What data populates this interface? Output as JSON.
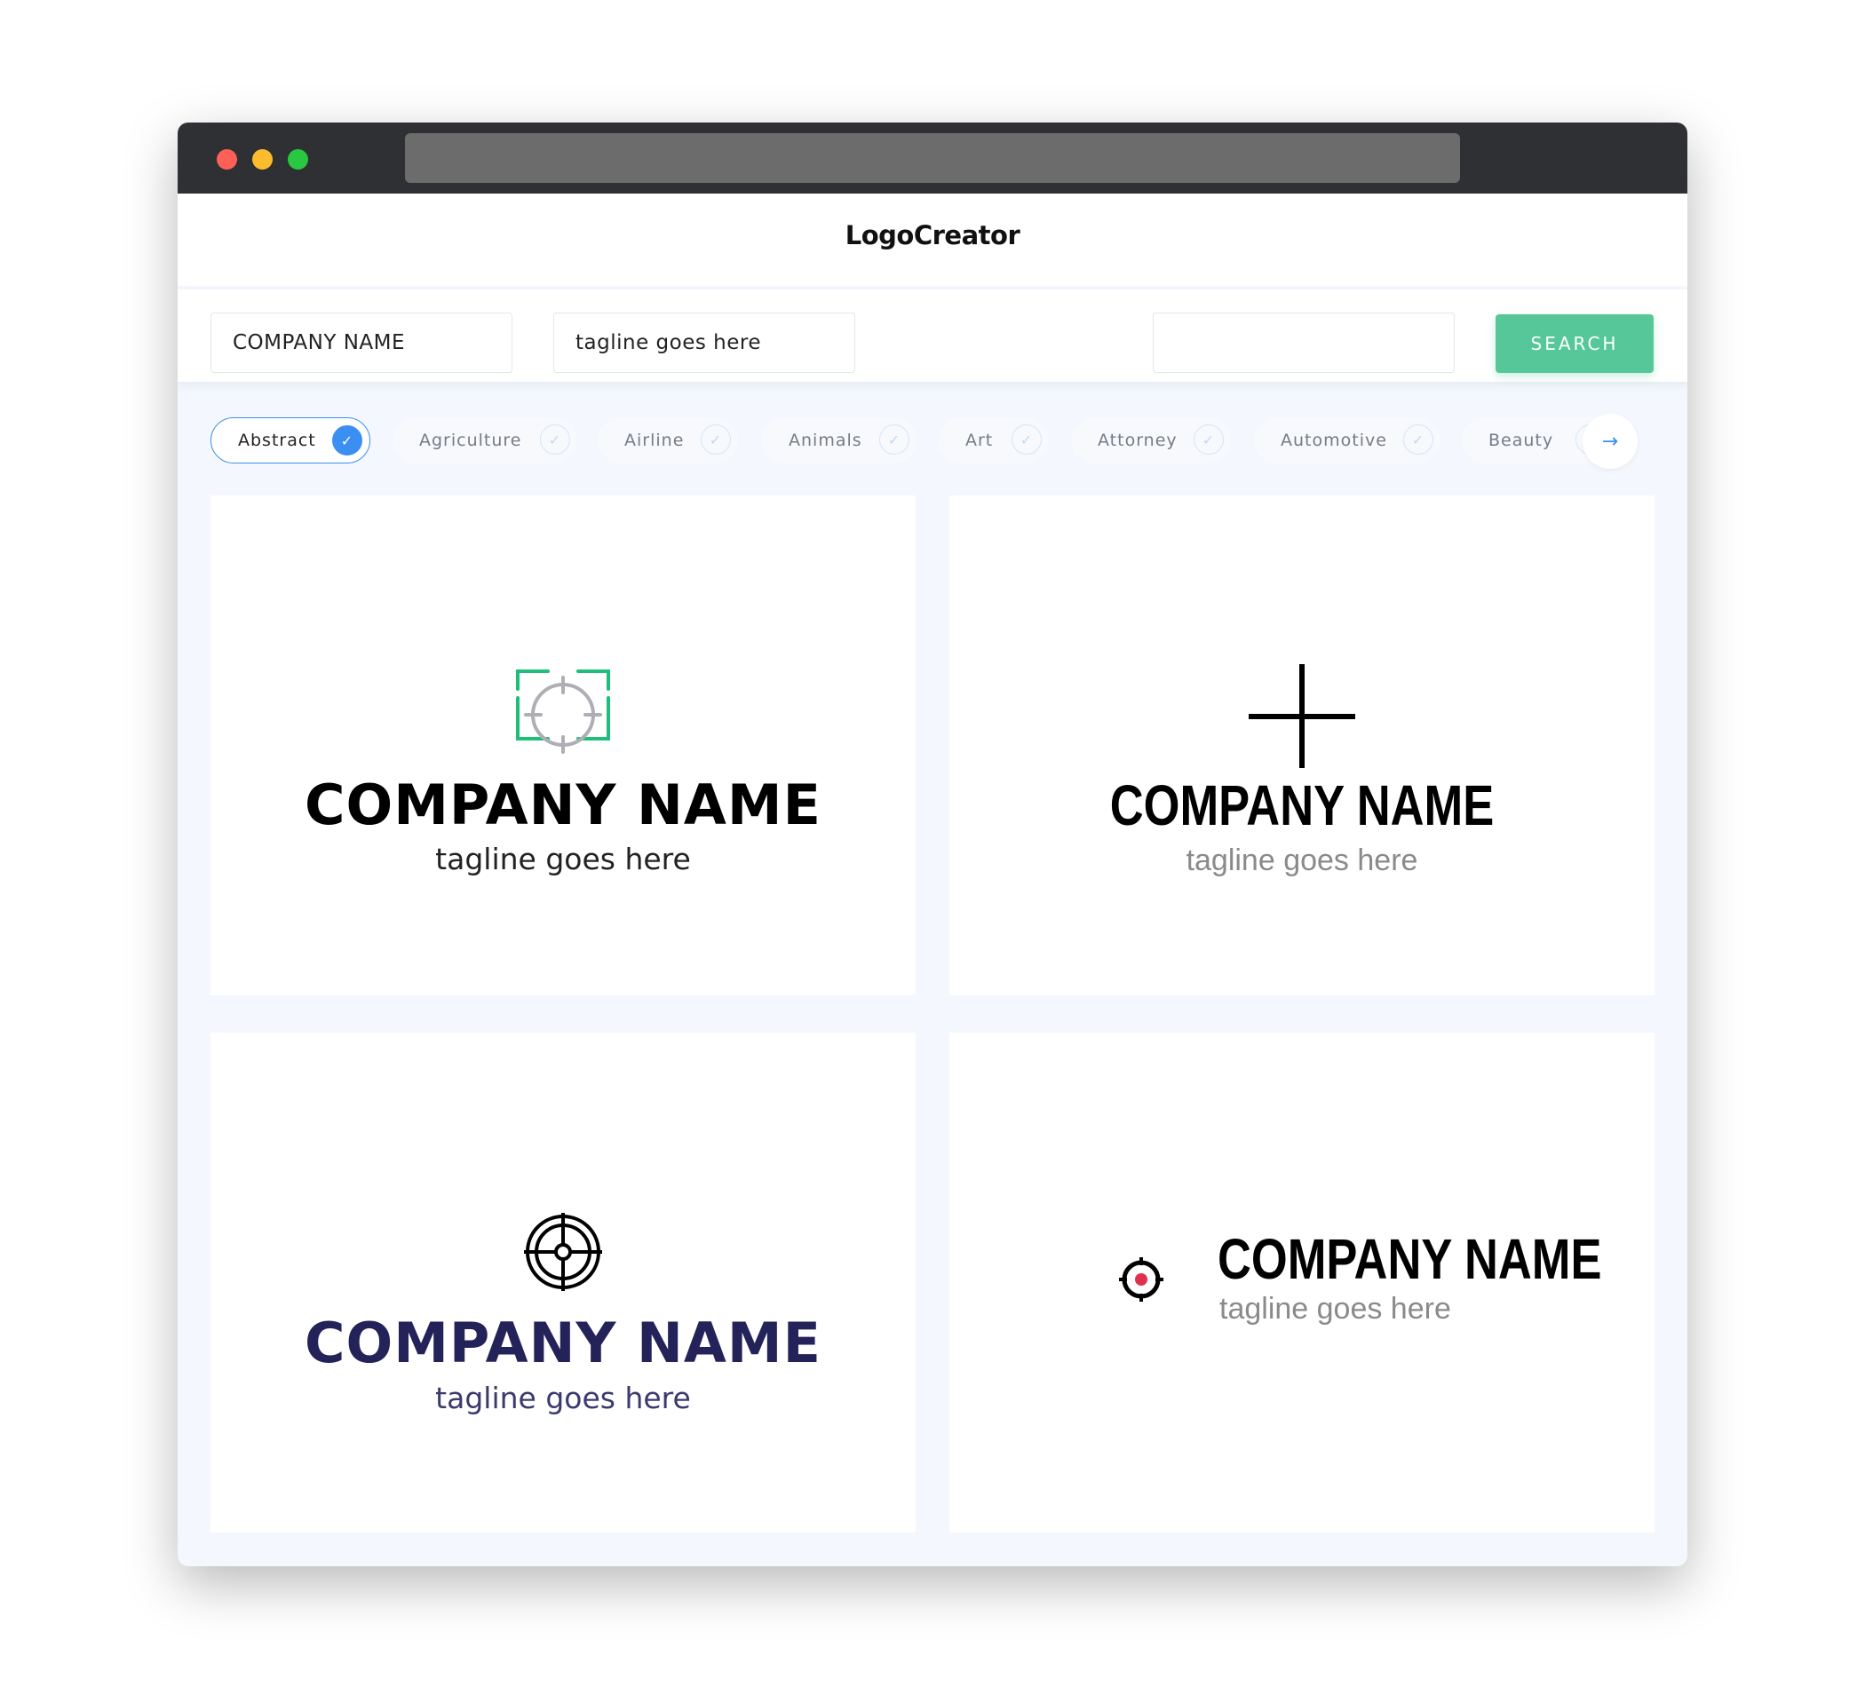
{
  "window": {
    "controls": [
      "close",
      "minimize",
      "maximize"
    ]
  },
  "header": {
    "brand": "LogoCreator"
  },
  "search": {
    "company_value": "COMPANY NAME",
    "tagline_value": "tagline goes here",
    "keyword_value": "",
    "button_label": "SEARCH"
  },
  "categories": [
    {
      "label": "Abstract",
      "selected": true
    },
    {
      "label": "Agriculture",
      "selected": false
    },
    {
      "label": "Airline",
      "selected": false
    },
    {
      "label": "Animals",
      "selected": false
    },
    {
      "label": "Art",
      "selected": false
    },
    {
      "label": "Attorney",
      "selected": false
    },
    {
      "label": "Automotive",
      "selected": false
    },
    {
      "label": "Beauty",
      "selected": false
    }
  ],
  "check_glyph": "✓",
  "next_glyph": "→",
  "logos": [
    {
      "company": "COMPANY NAME",
      "tagline": "tagline goes here",
      "icon": "crosshair-frame-icon",
      "name_color": "#000000",
      "tag_color": "#222222",
      "accent": "#1fbf7a",
      "icon_color": "#b0aeb5"
    },
    {
      "company": "COMPANY NAME",
      "tagline": "tagline goes here",
      "icon": "plus-cross-icon",
      "name_color": "#000000",
      "tag_color": "#8a8a8a",
      "icon_color": "#000000"
    },
    {
      "company": "COMPANY NAME",
      "tagline": "tagline goes here",
      "icon": "target-scope-icon",
      "name_color": "#23235a",
      "tag_color": "#3a3a6e",
      "icon_color": "#000000"
    },
    {
      "company": "COMPANY NAME",
      "tagline": "tagline goes here",
      "icon": "red-dot-crosshair-icon",
      "name_color": "#000000",
      "tag_color": "#8a8a8a",
      "icon_color": "#000000",
      "accent": "#e0304e"
    }
  ]
}
